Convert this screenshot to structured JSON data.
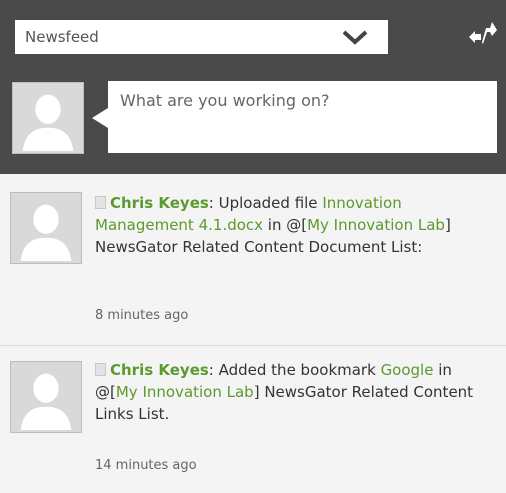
{
  "header": {
    "feed_selector": {
      "value": "Newsfeed"
    },
    "post_box": {
      "placeholder": "What are you working on?"
    }
  },
  "activities": [
    {
      "author": "Chris Keyes",
      "action": ": Uploaded file ",
      "target": "Innovation Management 4.1.docx",
      "in_text": " in @[",
      "location": "My Innovation Lab",
      "rest": "] NewsGator Related Content Document List:",
      "time": "8 minutes ago"
    },
    {
      "author": "Chris Keyes",
      "action": ": Added the bookmark ",
      "target": "Google",
      "in_text": " in @[",
      "location": "My Innovation Lab",
      "rest": "] NewsGator Related Content Links List.",
      "time": "14 minutes ago"
    }
  ],
  "colors": {
    "header_bg": "#4a4a4a",
    "link_green": "#5b9a2e",
    "panel_bg": "#f4f4f4"
  }
}
